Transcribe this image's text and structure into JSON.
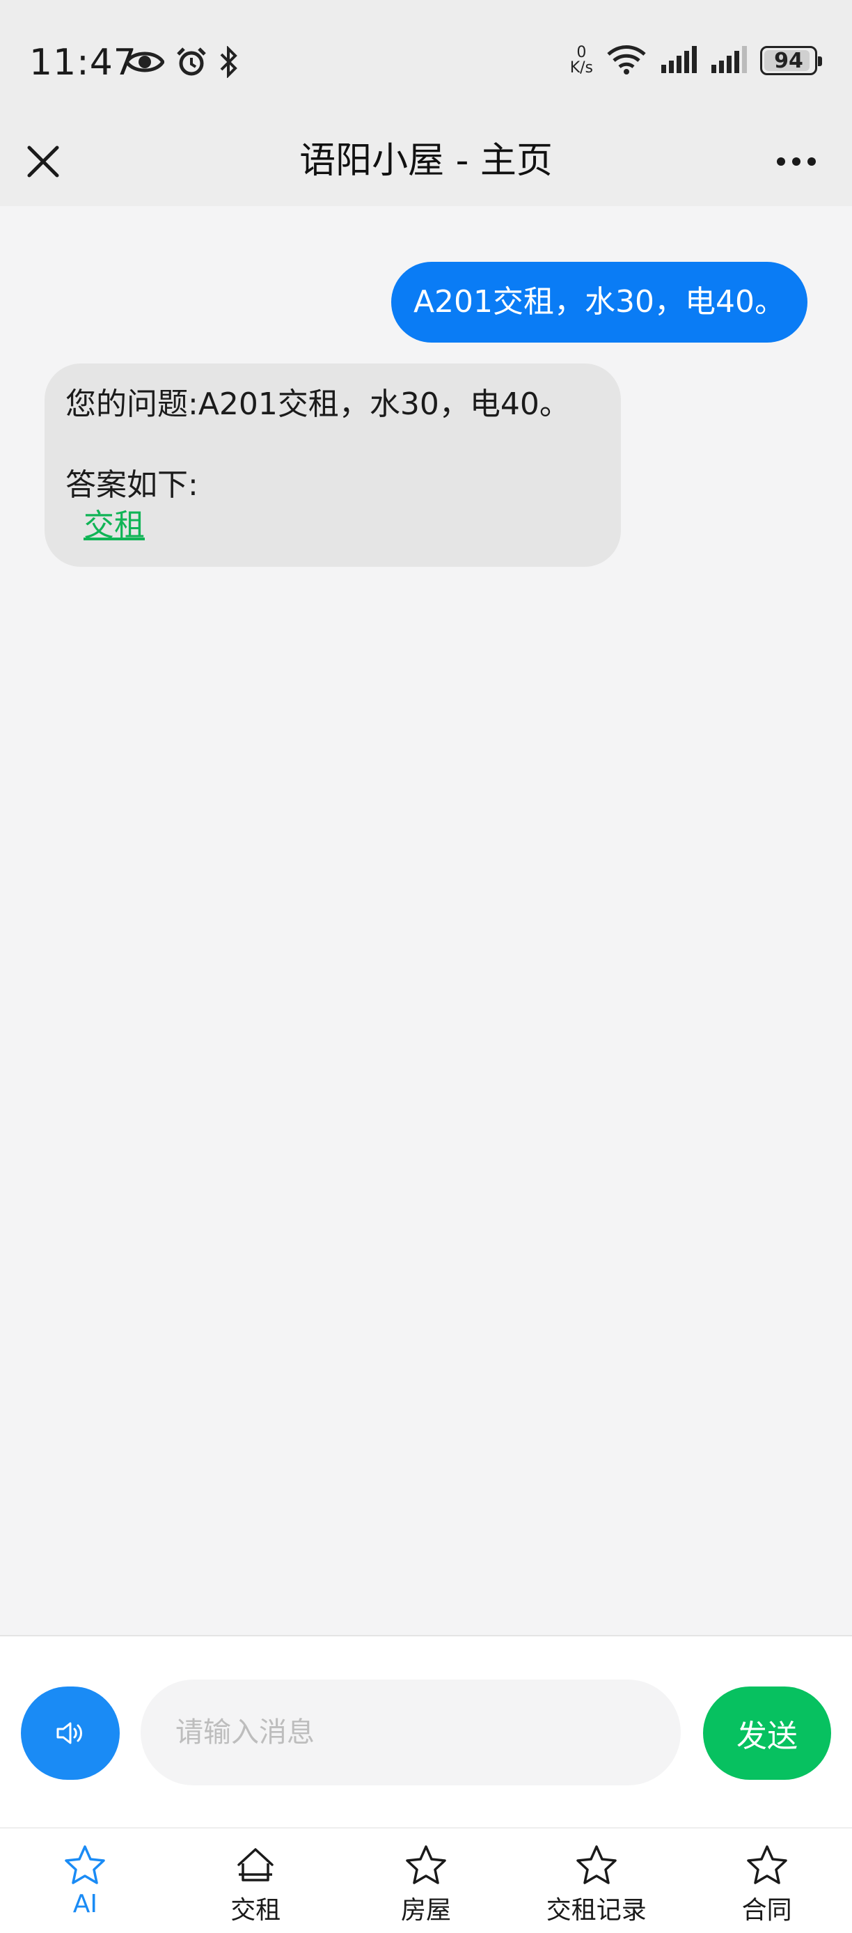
{
  "status_bar": {
    "time": "11:47",
    "net_speed_value": "0",
    "net_speed_unit": "K/s",
    "battery_level": 94,
    "battery_text": "94"
  },
  "header": {
    "title": "语阳小屋 - 主页"
  },
  "chat": {
    "messages": [
      {
        "role": "user",
        "text": "A201交租，水30，电40。"
      },
      {
        "role": "bot",
        "question_text": "您的问题:A201交租，水30，电40。",
        "answer_label": "答案如下:",
        "link_text": "交租"
      }
    ]
  },
  "input_bar": {
    "placeholder": "请输入消息",
    "send_label": "发送"
  },
  "tabs": [
    {
      "label": "AI",
      "icon": "star-icon",
      "active": true
    },
    {
      "label": "交租",
      "icon": "home-icon",
      "active": false
    },
    {
      "label": "房屋",
      "icon": "star-icon",
      "active": false
    },
    {
      "label": "交租记录",
      "icon": "star-icon",
      "active": false
    },
    {
      "label": "合同",
      "icon": "star-icon",
      "active": false
    }
  ],
  "colors": {
    "accent": "#1a8bf5",
    "user_bubble": "#0a7cf5",
    "send_green": "#07c160",
    "link_green": "#10b456"
  }
}
